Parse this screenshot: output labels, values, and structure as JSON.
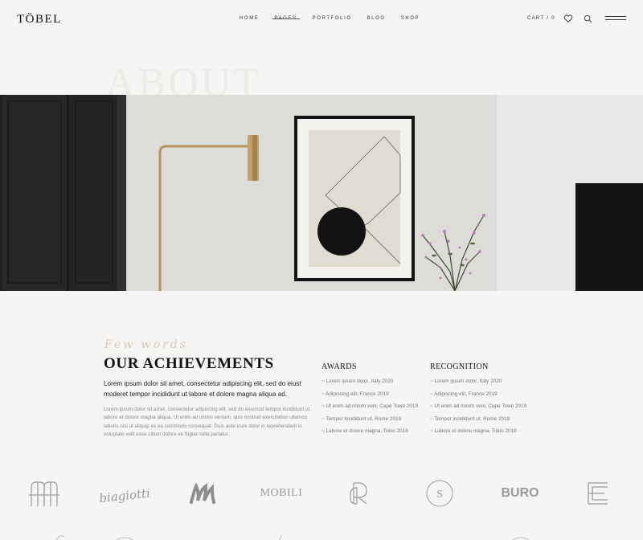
{
  "header": {
    "logo": "TÖBEL",
    "nav": [
      "HOME",
      "PAGES",
      "PORTFOLIO",
      "BLOG",
      "SHOP"
    ],
    "active_nav_index": 1,
    "cart": "CART / 0",
    "icons": [
      "heart-icon",
      "search-icon",
      "menu-icon"
    ]
  },
  "hero": {
    "watermark": "ABOUT"
  },
  "achievements": {
    "script_label": "Few words",
    "heading": "OUR ACHIEVEMENTS",
    "lead": "Lorem ipsum dolor sit amet, consectetur adipiscing elit, sed do eiust moderet tempor incididunt ut labore et dolore magna aliqua ad.",
    "body": "Lorem ipsum dolor sit amet, consectetur adipiscing elit, sed do eiusmod tempor incididunt ut labore et dolore magna aliqua. Ut enim ad minim veniam, quis nostrud exercitation ullamco laboris nisi ut aliquip ex ea commodo consequat. Duis aute irure dolor in reprehenderit in voluptate velit esse cillum dolore eu fugiat nulla pariatur.",
    "awards": {
      "title": "AWARDS",
      "items": [
        "~ Lorem ipsum dolor, Italy 2020",
        "~ Adipiscing elit, France 2019",
        "~ Ut enim ad minim veni, Cape Town 2019",
        "~ Tempor incididunt ut, Rome 2019",
        "~ Labore et dolore magna, Tokio 2018"
      ]
    },
    "recognition": {
      "title": "RECOGNITION",
      "items": [
        "~ Lorem ipsum dolor, Italy 2020",
        "~ Adipiscing elit, France 2019",
        "~ Ut enim ad minim veni, Cape Town 2019",
        "~ Tempor incididunt ut, Rome 2019",
        "~ Labore et dolore magna, Tokio 2018"
      ]
    }
  },
  "partner_logos": {
    "signature": "biagiotti",
    "mobili": "MOBILI",
    "s_badge": "S",
    "buro": "BURO"
  },
  "colors": {
    "background": "#f6f5f3",
    "accent_script": "#d2bfa3",
    "logo_gray": "#9a9a9a"
  }
}
